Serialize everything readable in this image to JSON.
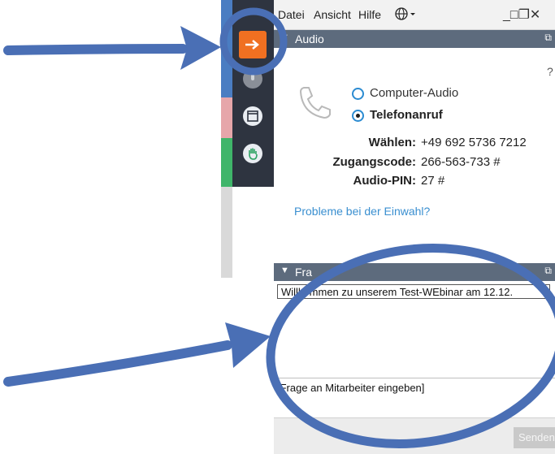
{
  "menu": {
    "file": "Datei",
    "view": "Ansicht",
    "help": "Hilfe",
    "window_controls": "_□❐✕"
  },
  "audio_panel": {
    "title": "Audio",
    "help": "?",
    "option_computer": "Computer-Audio",
    "option_phone": "Telefonanruf",
    "selected": "Telefonanruf",
    "dial_label": "Wählen:",
    "dial_value": "+49 692 5736 7212",
    "access_label": "Zugangscode:",
    "access_value": "266-563-733 #",
    "pin_label": "Audio-PIN:",
    "pin_value": "27 #",
    "problems_link": "Probleme bei der Einwahl?"
  },
  "questions_panel": {
    "title": "Fra",
    "question": "Willkommen zu unserem Test-WEbinar am 12.12.",
    "input_placeholder": "[Frage an Mitarbeiter eingeben]",
    "send_label": "Senden"
  },
  "icons": [
    "arrow-right-icon",
    "microphone-icon",
    "window-icon",
    "raise-hand-icon",
    "phone-icon",
    "globe-icon"
  ],
  "colors": {
    "toolbar": "#2e3440",
    "accent_orange": "#f07021",
    "header": "#5d6b7d",
    "link": "#3a8fd0",
    "annotation": "#4a6fb5"
  }
}
